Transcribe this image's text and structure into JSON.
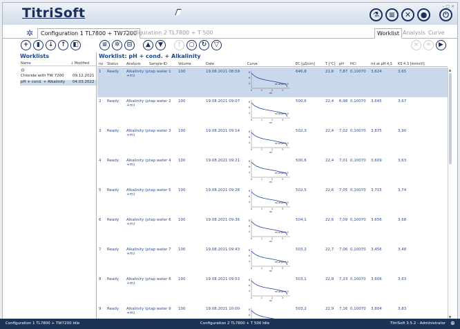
{
  "app": {
    "title": "TitriSoft"
  },
  "tabs": {
    "config1": "Configuration 1 TL7800 + TW7200",
    "config2": "Configuration 2 TL7800 + T 500",
    "worklist": "Worklist",
    "analysis": "Analysis",
    "curve": "Curve"
  },
  "worklists": {
    "title": "Worklists",
    "col_name": "Name",
    "col_modified": "↓ Modified",
    "items": [
      {
        "name": "Chloride with TW 7200",
        "modified": "09.12.2021"
      },
      {
        "name": "pH + cond. + Alkalinity",
        "modified": "04.03.2022"
      }
    ]
  },
  "worklist_view": {
    "title": "Worklist: pH + cond. + Alkalinity",
    "columns": [
      "no",
      "Status",
      "Analysis",
      "Sample-ID",
      "Volume",
      "Date",
      "Curve",
      "EC [µS/cm]",
      "T [°C]",
      "pH",
      "HCl",
      "ml at pH 4,5",
      "KS 4.3 [mmol/l]"
    ],
    "curve_label": "ml at pH 4,5",
    "curve_unit": "ml",
    "curve_y_ticks": [
      "8",
      "6",
      "4"
    ],
    "curve_x_ticks": [
      "0",
      "1",
      "2",
      "3"
    ],
    "rows": [
      {
        "no": "1",
        "status": "Ready",
        "analysis": "Alkalinity (p",
        "analysis2": "+m)",
        "sample": "tap water 1",
        "volume": "100",
        "date": "19.08.2021 08:59",
        "ec": "646,8",
        "t": "22,6",
        "ph": "7,87",
        "hcl": "0,10070",
        "ml": "3,624",
        "ks": "3,65"
      },
      {
        "no": "2",
        "status": "Ready",
        "analysis": "Alkalinity (p",
        "analysis2": "+m)",
        "sample": "tap water 2",
        "volume": "100",
        "date": "19.08.2021 09:07",
        "ec": "500,6",
        "t": "22,4",
        "ph": "6,98",
        "hcl": "0,10070",
        "ml": "3,645",
        "ks": "3,67"
      },
      {
        "no": "3",
        "status": "Ready",
        "analysis": "Alkalinity (p",
        "analysis2": "+m)",
        "sample": "tap water 3",
        "volume": "100",
        "date": "19.08.2021 09:14",
        "ec": "502,3",
        "t": "22,4",
        "ph": "7,02",
        "hcl": "0,10070",
        "ml": "3,875",
        "ks": "3,90"
      },
      {
        "no": "4",
        "status": "Ready",
        "analysis": "Alkalinity (p",
        "analysis2": "+m)",
        "sample": "tap water 4",
        "volume": "100",
        "date": "19.08.2021 09:21",
        "ec": "500,6",
        "t": "22,4",
        "ph": "7,01",
        "hcl": "0,10070",
        "ml": "3,609",
        "ks": "3,63"
      },
      {
        "no": "5",
        "status": "Ready",
        "analysis": "Alkalinity (p",
        "analysis2": "+m)",
        "sample": "tap water 5",
        "volume": "100",
        "date": "19.08.2021 09:28",
        "ec": "502,5",
        "t": "22,6",
        "ph": "7,05",
        "hcl": "0,10070",
        "ml": "3,715",
        "ks": "3,74"
      },
      {
        "no": "6",
        "status": "Ready",
        "analysis": "Alkalinity (p",
        "analysis2": "+m)",
        "sample": "tap water 6",
        "volume": "100",
        "date": "19.08.2021 09:36",
        "ec": "504,1",
        "t": "22,6",
        "ph": "7,09",
        "hcl": "0,10070",
        "ml": "3,656",
        "ks": "3,68"
      },
      {
        "no": "7",
        "status": "Ready",
        "analysis": "Alkalinity (p",
        "analysis2": "+m)",
        "sample": "tap water 7",
        "volume": "100",
        "date": "19.08.2021 09:43",
        "ec": "503,2",
        "t": "22,7",
        "ph": "7,06",
        "hcl": "0,10070",
        "ml": "3,456",
        "ks": "3,48"
      },
      {
        "no": "8",
        "status": "Ready",
        "analysis": "Alkalinity (p",
        "analysis2": "+m)",
        "sample": "tap water 8",
        "volume": "100",
        "date": "19.08.2021 09:53",
        "ec": "503,1",
        "t": "22,8",
        "ph": "7,23",
        "hcl": "0,10070",
        "ml": "3,606",
        "ks": "3,63"
      },
      {
        "no": "9",
        "status": "Ready",
        "analysis": "Alkalinity (p",
        "analysis2": "+m)",
        "sample": "tap water 9",
        "volume": "100",
        "date": "19.08.2021 10:00",
        "ec": "503,2",
        "t": "22,9",
        "ph": "7,16",
        "hcl": "0,10070",
        "ml": "3,804",
        "ks": "3,83"
      }
    ]
  },
  "status": {
    "left": "Configuration 1 TL7800 + TW7200  Idle",
    "middle": "Configuration 2 TL7800 + T 500  Idle",
    "right": "TitriSoft 3.5.2 - Administrator"
  },
  "colors": {
    "brand": "#1a2f5c",
    "selection": "#c9d9eb",
    "statusbar": "#1c3358"
  }
}
